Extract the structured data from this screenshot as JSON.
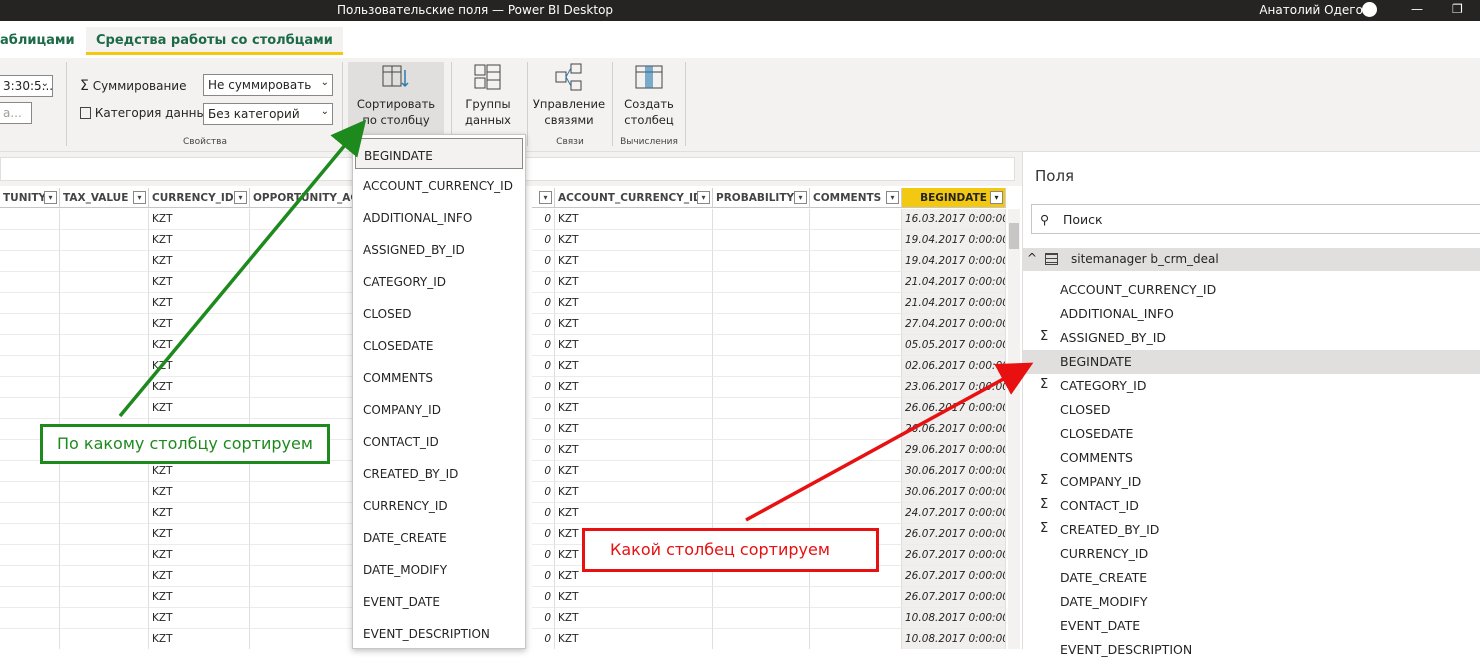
{
  "window": {
    "title": "Пользовательские поля — Power BI Desktop",
    "user": "Анатолий Одегов",
    "minimize_icon": "minimize-icon",
    "restore_icon": "restore-icon"
  },
  "tabs": {
    "table_tools": "аблицами",
    "column_tools": "Средства работы со столбцами"
  },
  "ribbon": {
    "format_value": "3:30:5...",
    "format2_value": "а...",
    "summarize_label": "Суммирование",
    "summarize_value": "Не суммировать",
    "category_label": "Категория данных",
    "category_value": "Без категорий",
    "properties_group": "Свойства",
    "sort_by_column": "Сортировать по столбцу",
    "data_groups": "Группы данных",
    "manage_relationships": "Управление связями",
    "relationships_group": "Связи",
    "new_column": "Создать столбец",
    "calculations_group": "Вычисления"
  },
  "grid": {
    "headers": [
      "TUNITY",
      "TAX_VALUE",
      "CURRENCY_ID",
      "OPPORTUNITY_ACC",
      "ACCOUNT_CURRENCY_ID",
      "PROBABILITY",
      "COMMENTS",
      "BEGINDATE"
    ],
    "currency": "KZT",
    "zero": "0",
    "dates": [
      "16.03.2017 0:00:00",
      "19.04.2017 0:00:00",
      "19.04.2017 0:00:00",
      "21.04.2017 0:00:00",
      "21.04.2017 0:00:00",
      "27.04.2017 0:00:00",
      "05.05.2017 0:00:00",
      "02.06.2017 0:00:00",
      "23.06.2017 0:00:00",
      "26.06.2017 0:00:00",
      "26.06.2017 0:00:00",
      "29.06.2017 0:00:00",
      "30.06.2017 0:00:00",
      "30.06.2017 0:00:00",
      "24.07.2017 0:00:00",
      "26.07.2017 0:00:00",
      "26.07.2017 0:00:00",
      "26.07.2017 0:00:00",
      "26.07.2017 0:00:00",
      "10.08.2017 0:00:00",
      "10.08.2017 0:00:00"
    ]
  },
  "sort_dropdown": {
    "options": [
      "BEGINDATE",
      "ACCOUNT_CURRENCY_ID",
      "ADDITIONAL_INFO",
      "ASSIGNED_BY_ID",
      "CATEGORY_ID",
      "CLOSED",
      "CLOSEDATE",
      "COMMENTS",
      "COMPANY_ID",
      "CONTACT_ID",
      "CREATED_BY_ID",
      "CURRENCY_ID",
      "DATE_CREATE",
      "DATE_MODIFY",
      "EVENT_DATE",
      "EVENT_DESCRIPTION"
    ]
  },
  "fields_pane": {
    "title": "Поля",
    "search_placeholder": "Поиск",
    "table_name": "sitemanager b_crm_deal",
    "items": [
      {
        "name": "ACCOUNT_CURRENCY_ID",
        "sigma": false
      },
      {
        "name": "ADDITIONAL_INFO",
        "sigma": false
      },
      {
        "name": "ASSIGNED_BY_ID",
        "sigma": true
      },
      {
        "name": "BEGINDATE",
        "sigma": false
      },
      {
        "name": "CATEGORY_ID",
        "sigma": true
      },
      {
        "name": "CLOSED",
        "sigma": false
      },
      {
        "name": "CLOSEDATE",
        "sigma": false
      },
      {
        "name": "COMMENTS",
        "sigma": false
      },
      {
        "name": "COMPANY_ID",
        "sigma": true
      },
      {
        "name": "CONTACT_ID",
        "sigma": true
      },
      {
        "name": "CREATED_BY_ID",
        "sigma": true
      },
      {
        "name": "CURRENCY_ID",
        "sigma": false
      },
      {
        "name": "DATE_CREATE",
        "sigma": false
      },
      {
        "name": "DATE_MODIFY",
        "sigma": false
      },
      {
        "name": "EVENT_DATE",
        "sigma": false
      },
      {
        "name": "EVENT_DESCRIPTION",
        "sigma": false
      }
    ],
    "sigma": "Σ"
  },
  "annotations": {
    "green": "По какому столбцу сортируем",
    "red": "Какой столбец сортируем"
  },
  "colors": {
    "accent": "#f2c811",
    "green": "#1e8a1e",
    "red": "#e81010",
    "title_bar": "#252423"
  }
}
